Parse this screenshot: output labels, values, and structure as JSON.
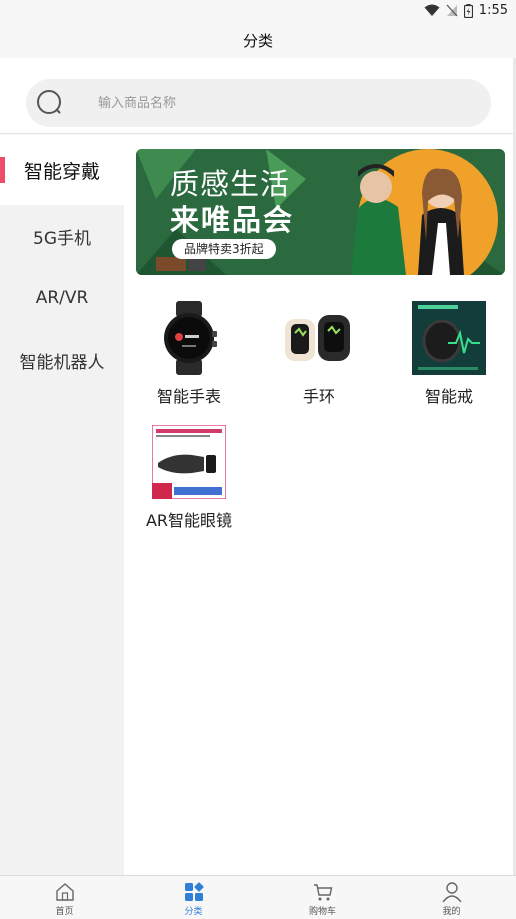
{
  "status_bar": {
    "time": "1:55"
  },
  "header": {
    "title": "分类"
  },
  "search": {
    "placeholder": "输入商品名称",
    "value": ""
  },
  "sidebar": {
    "items": [
      {
        "label": "智能穿戴",
        "active": true
      },
      {
        "label": "5G手机",
        "active": false
      },
      {
        "label": "AR/VR",
        "active": false
      },
      {
        "label": "智能机器人",
        "active": false
      }
    ]
  },
  "banner": {
    "line1": "质感生活",
    "line2": "来唯品会",
    "pill": "品牌特卖3折起"
  },
  "products": [
    {
      "label": "智能手表",
      "icon": "smartwatch-image"
    },
    {
      "label": "手环",
      "icon": "fitness-band-image"
    },
    {
      "label": "智能戒",
      "icon": "smart-ring-image"
    },
    {
      "label": "AR智能眼镜",
      "icon": "ar-glasses-image"
    }
  ],
  "tabbar": {
    "tabs": [
      {
        "label": "首页",
        "icon": "home-icon",
        "active": false
      },
      {
        "label": "分类",
        "icon": "category-icon",
        "active": true
      },
      {
        "label": "购物车",
        "icon": "cart-icon",
        "active": false
      },
      {
        "label": "我的",
        "icon": "user-icon",
        "active": false
      }
    ]
  },
  "colors": {
    "accent": "#f04e68",
    "tab_active": "#2f7fd8",
    "banner_green": "#2b6a3f",
    "banner_orange": "#f0a12a"
  }
}
